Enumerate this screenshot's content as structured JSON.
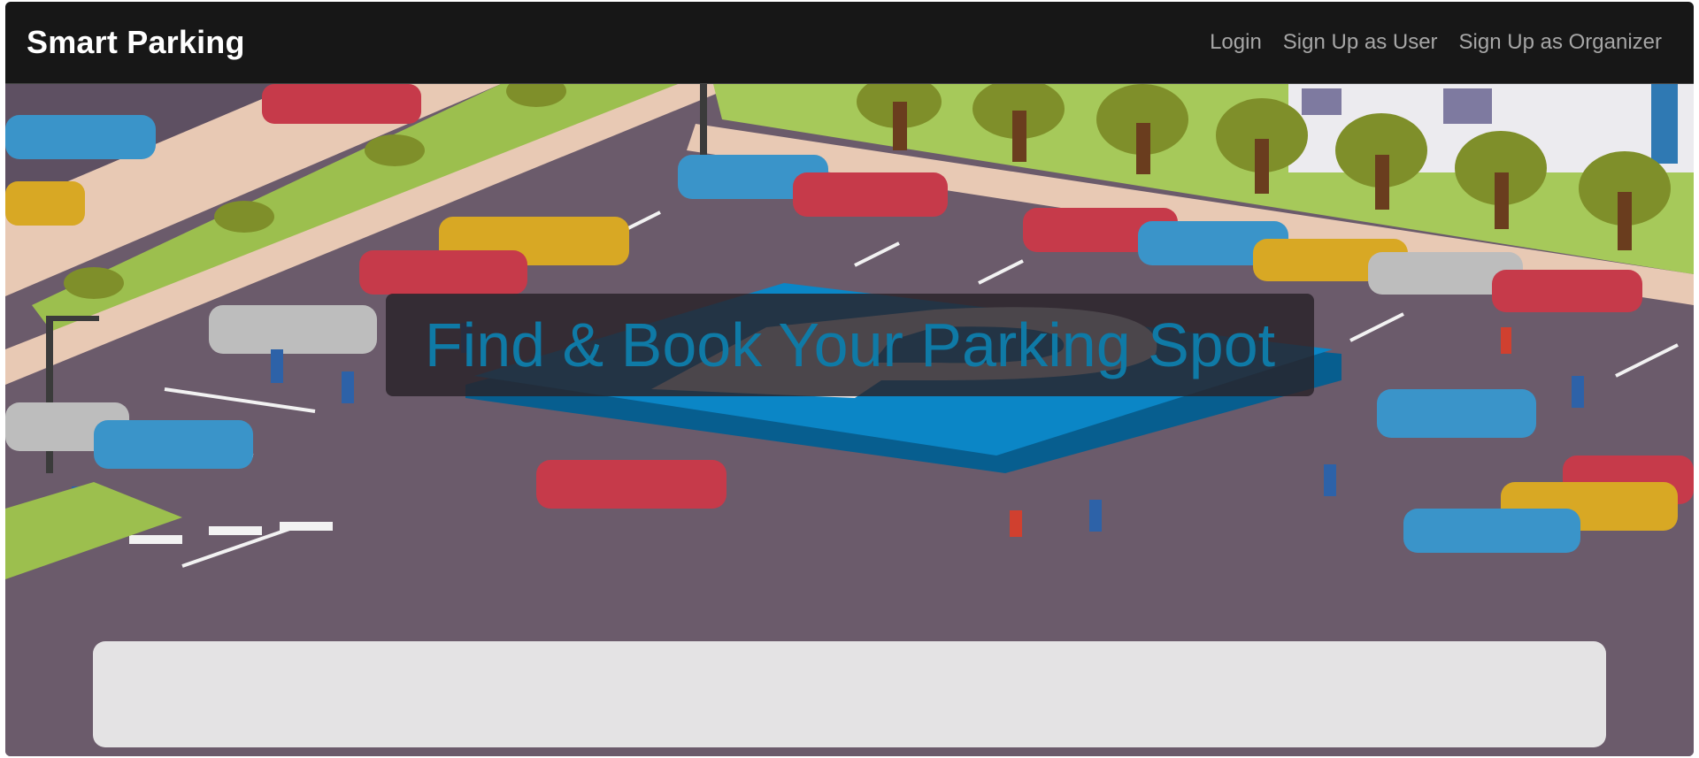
{
  "navbar": {
    "brand": "Smart Parking",
    "links": [
      "Login",
      "Sign Up as User",
      "Sign Up as Organizer"
    ]
  },
  "hero": {
    "headline": "Find & Book Your Parking Spot",
    "colors": {
      "headline": "#0f7aa6",
      "navbar": "#171717",
      "nav_link": "#a6a6a6",
      "asphalt": "#6b5b6b",
      "parking_sign": "#0b86c6"
    }
  }
}
